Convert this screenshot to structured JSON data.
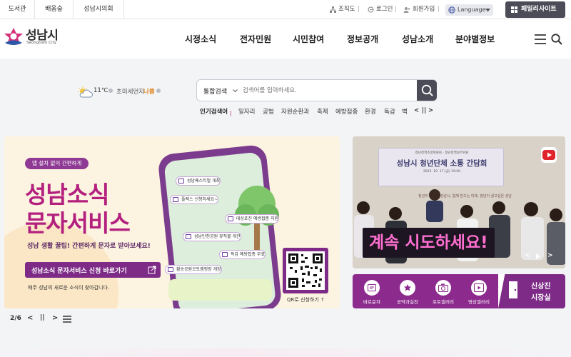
{
  "top_links": [
    "도서관",
    "배움숲",
    "성남시의회"
  ],
  "utility": {
    "org_chart": "조직도",
    "login": "로그인",
    "signup": "회원가입",
    "language": "Language",
    "family_site": "패밀리사이트"
  },
  "logo": {
    "name": "성남시",
    "sub": "Seongnam City"
  },
  "nav": [
    "시정소식",
    "전자민원",
    "시민참여",
    "정보공개",
    "성남소개",
    "분야별정보"
  ],
  "weather": {
    "temp": "11℃",
    "dust_label": "초미세먼지",
    "dust_value": "나쁨"
  },
  "search": {
    "scope": "통합검색",
    "placeholder": "검색어를 입력하세요."
  },
  "popular": {
    "label": "인기검색어",
    "keywords": [
      "일자리",
      "공범",
      "자원순환과",
      "축제",
      "예방접종",
      "환경",
      "독감",
      "벽"
    ]
  },
  "banner_main": {
    "tag": "앱 설치 없이 간편하게",
    "title_line1": "성남소식",
    "title_line2": "문자서비스",
    "subtitle": "성남 생활 꿀팁! 간편하게 문자로 받아보세요!",
    "cta": "성남소식 문자서비스 신청 바로가기",
    "note": "매주 성남의 새로운 소식이 찾아갑니다.",
    "qr_label": "QR로 신청하기 ↑",
    "chat_items": [
      "성남페스티벌 개최",
      "플렉스 신청하세요~",
      "대상포진 예방접종 지원",
      "성남탄천공원 뮤직볼 개관",
      "독감 예방접종 무료",
      "황송공원오토캠핑장 개장"
    ]
  },
  "pager": {
    "current": "2",
    "total": "6",
    "prev": "<",
    "pause": "||",
    "next": ">"
  },
  "banner_video": {
    "event_small": "청년정책조정위원회 · 청년정책실무위원",
    "event_title": "성남시 청년단체 소통 간담회",
    "event_date": "2025. 10. 17.(금) 19:00",
    "handwriting": "청년이 바라는 성남시, 함께 만드는 미래, 청년이 살고싶은 성남",
    "caption": "계속 시도하세요!"
  },
  "quick_menu": [
    "바로문자",
    "공약과실천",
    "포토갤러리",
    "영상갤러리"
  ],
  "mayor": {
    "line1": "신상진",
    "line2": "시장실"
  },
  "colors": {
    "accent_purple": "#8c2a8d",
    "title_pink": "#b3207e",
    "dark_button": "#4b4c57",
    "dust_bad": "#e08a2a"
  }
}
